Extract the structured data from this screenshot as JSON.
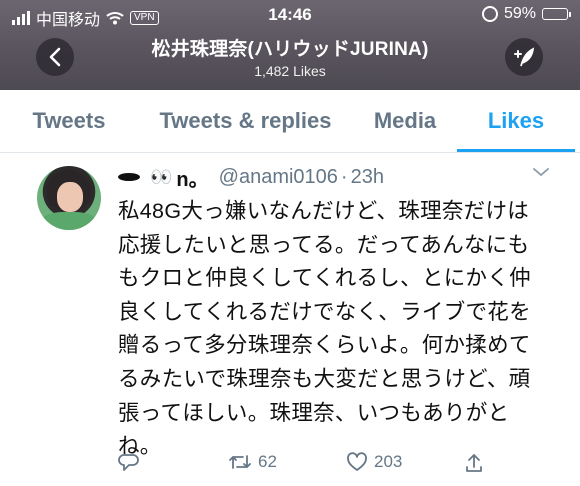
{
  "status_bar": {
    "carrier": "中国移动",
    "vpn": "VPN",
    "time": "14:46",
    "battery": "59%",
    "battery_level": 0.59
  },
  "header": {
    "title": "松井珠理奈(ハリウッドJURINA)",
    "subtitle": "1,482 Likes"
  },
  "tabs": [
    {
      "label": "Tweets",
      "active": false
    },
    {
      "label": "Tweets & replies",
      "active": false
    },
    {
      "label": "Media",
      "active": false
    },
    {
      "label": "Likes",
      "active": true
    }
  ],
  "tweet": {
    "name": "n。",
    "handle": "@anami0106",
    "time": "23h",
    "text_lines": [
      "私48G大っ嫌いなんだけど、珠理奈だけは",
      "応援したいと思ってる。だってあんなにも",
      "もクロと仲良くしてくれるし、とにかく仲",
      "良くしてくれるだけでなく、ライブで花を",
      "贈るって多分珠理奈くらいよ。何か揉めて",
      "るみたいで珠理奈も大変だと思うけど、頑",
      "張ってほしい。珠理奈、いつもありがと",
      "ね。"
    ],
    "retweets": "62",
    "likes": "203"
  },
  "colors": {
    "accent": "#1da1f2",
    "muted": "#657786"
  }
}
